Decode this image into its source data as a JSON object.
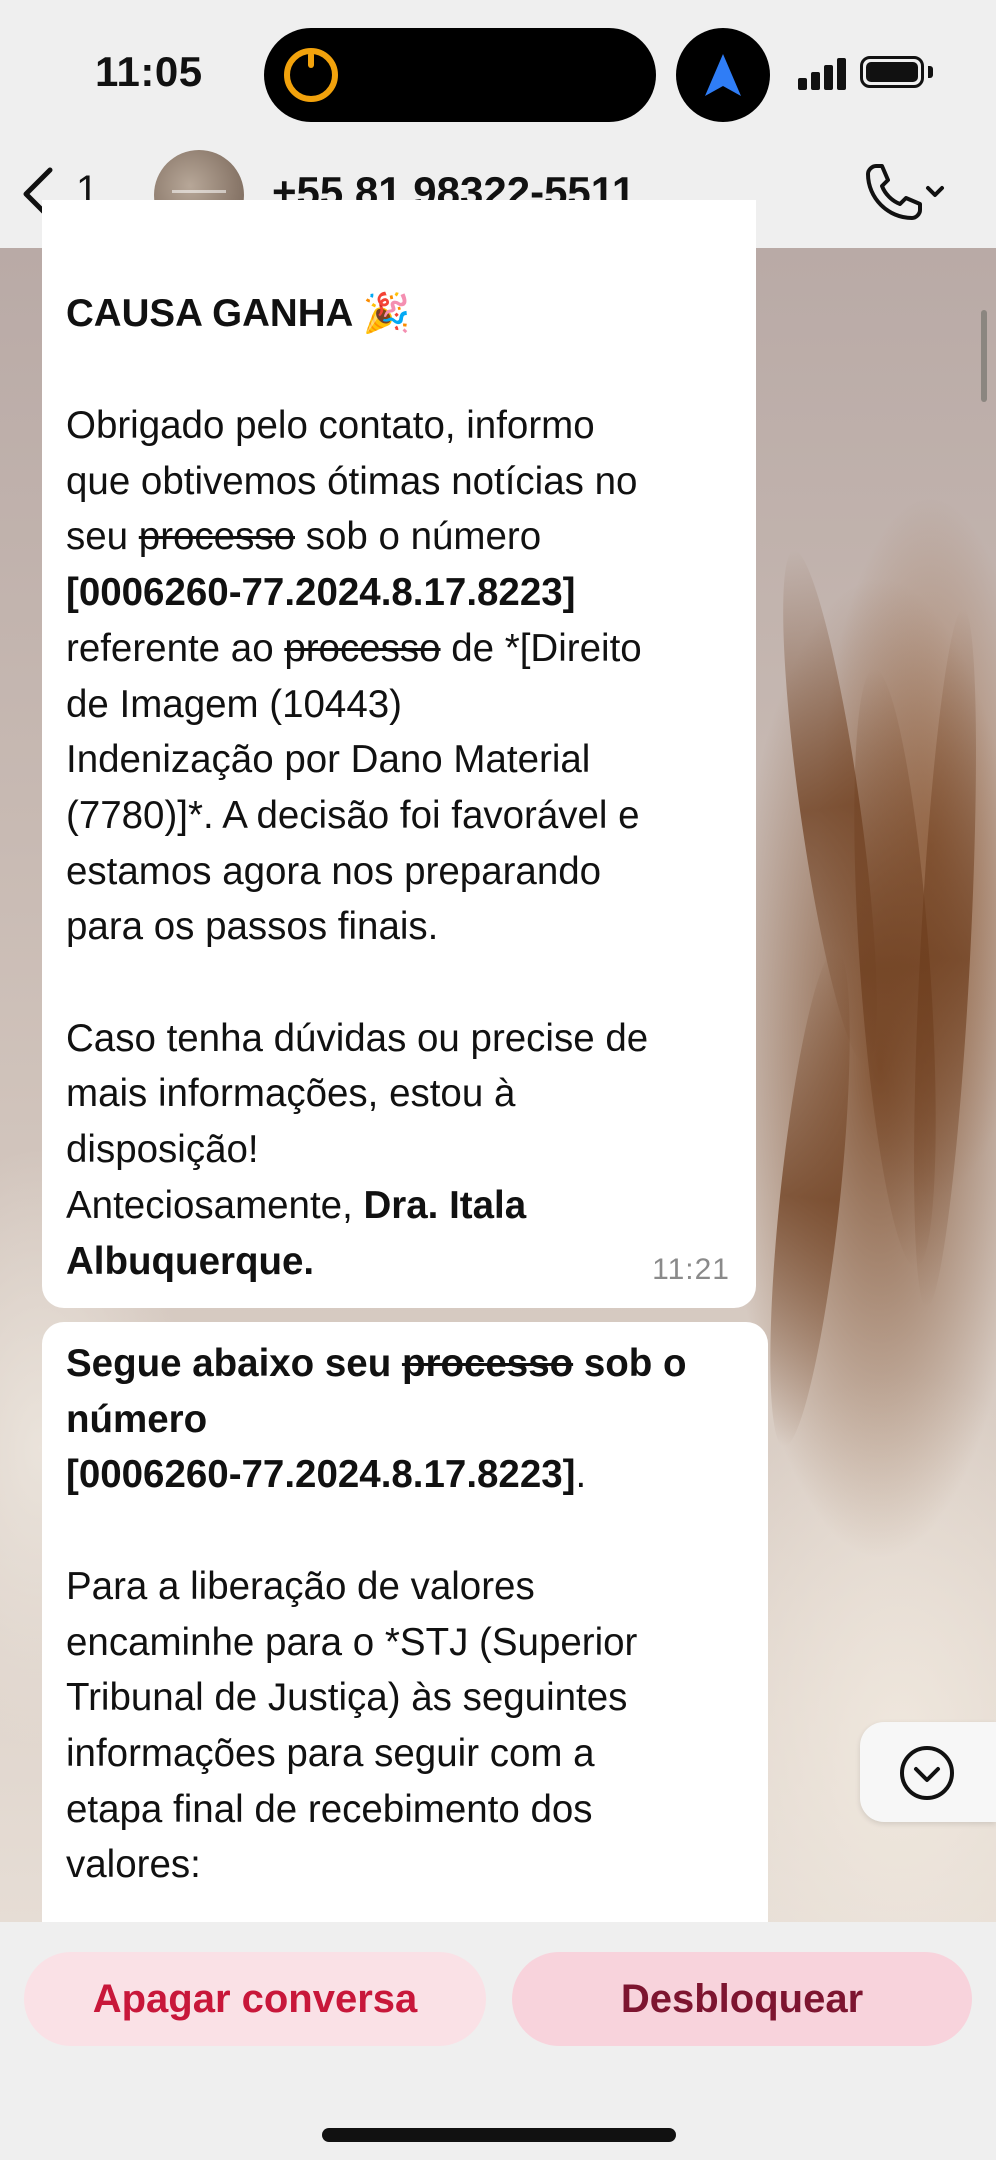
{
  "status_bar": {
    "time": "11:05"
  },
  "header": {
    "back_count": "1",
    "contact_name": "+55 81 98322-5511"
  },
  "messages": [
    {
      "title": "CAUSA GANHA",
      "title_emoji": "🎉",
      "lines": [
        "Obrigado pelo contato, informo",
        "que obtivemos ótimas notícias no",
        "seu ",
        "processo",
        " sob o número",
        "[0006260-77.2024.8.17.8223]",
        "referente ao ",
        "processo",
        " de *[Direito",
        "de Imagem (10443)",
        "Indenização por Dano Material",
        "(7780)]*. A decisão foi favorável e",
        "estamos agora nos preparando",
        "para os passos finais.",
        "Caso tenha dúvidas ou precise de",
        "mais informações, estou à",
        "disposição!",
        "Anteciosamente, ",
        "Dra. Itala",
        "Albuquerque."
      ],
      "time": "11:21"
    },
    {
      "lines": [
        "Segue abaixo seu ",
        "processo",
        " sob o",
        "número",
        "[0006260-77.2024.8.17.8223]",
        ".",
        "Para a liberação de valores",
        "encaminhe para o *STJ (Superior",
        "Tribunal de Justiça) às seguintes",
        "informações para seguir com a",
        "etapa final de recebimento dos",
        "valores:"
      ]
    }
  ],
  "bottom_bar": {
    "delete_label": "Apagar conversa",
    "unblock_label": "Desbloquear"
  },
  "icons": {
    "back": "chevron-left-icon",
    "call": "phone-icon",
    "scroll_down": "chevron-down-circle-icon",
    "location": "navigation-arrow-icon"
  },
  "colors": {
    "delete_text": "#c8173a",
    "unblock_text": "#7d1530",
    "bubble": "#ffffff"
  }
}
